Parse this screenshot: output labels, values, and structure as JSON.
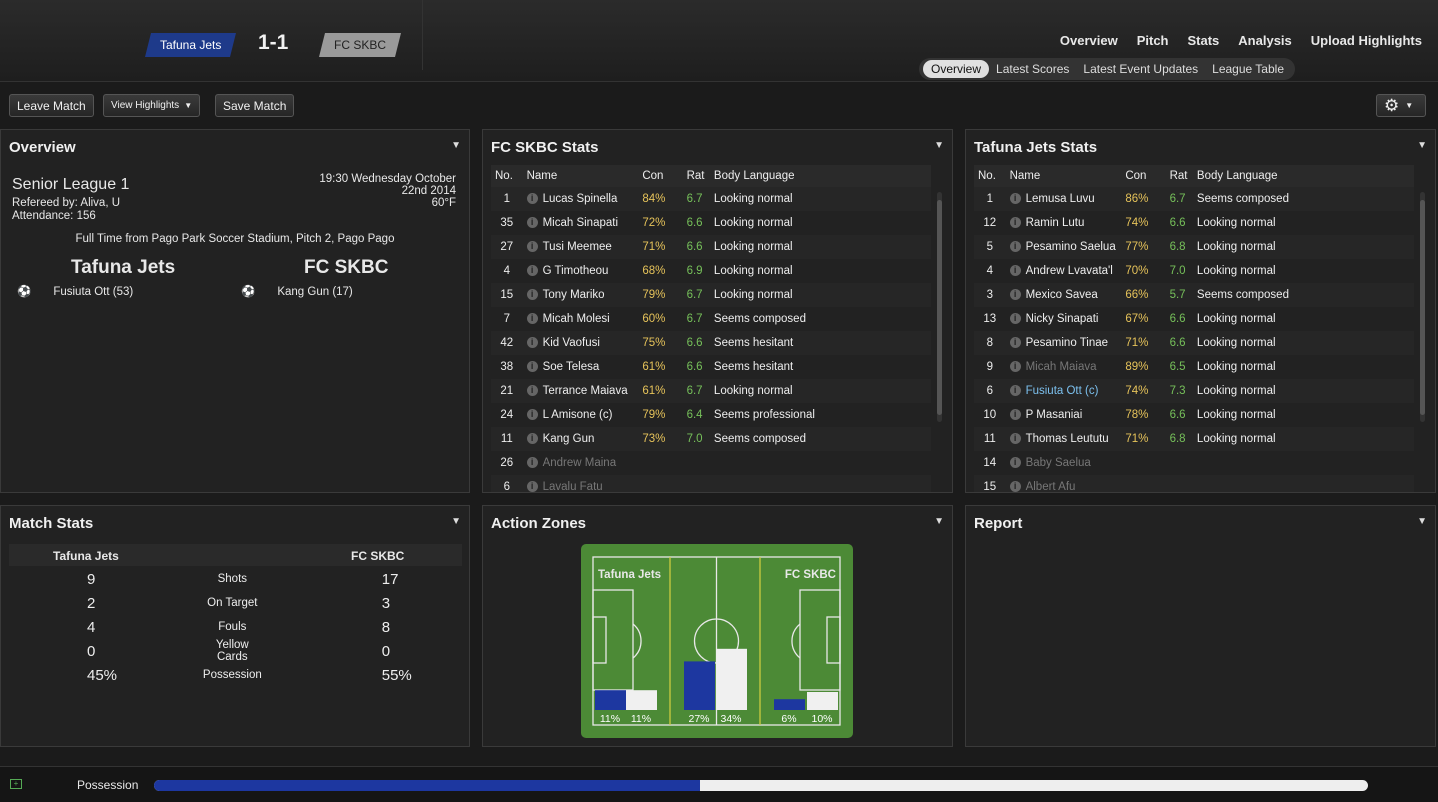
{
  "header": {
    "home_team": "Tafuna Jets",
    "away_team": "FC SKBC",
    "score": "1-1",
    "nav": [
      "Overview",
      "Pitch",
      "Stats",
      "Analysis",
      "Upload Highlights"
    ],
    "subnav": [
      "Overview",
      "Latest Scores",
      "Latest Event Updates",
      "League Table"
    ]
  },
  "toolbar": {
    "leave": "Leave Match",
    "highlights": "View Highlights",
    "save": "Save Match"
  },
  "overview": {
    "title": "Overview",
    "league": "Senior League 1",
    "referee": "Refereed by: Aliva, U",
    "attendance": "Attendance: 156",
    "datetime1": "19:30 Wednesday October",
    "datetime2": "22nd 2014",
    "temp": "60°F",
    "venue": "Full Time from Pago Park Soccer Stadium, Pitch 2, Pago Pago",
    "home": "Tafuna Jets",
    "away": "FC SKBC",
    "home_scorer": "Fusiuta Ott (53)",
    "away_scorer": "Kang Gun (17)"
  },
  "stats_headers": [
    "No.",
    "Name",
    "Con",
    "Rat",
    "Body Language"
  ],
  "fcskbc": {
    "title": "FC SKBC Stats",
    "rows": [
      [
        "1",
        "Lucas Spinella",
        "84%",
        "6.7",
        "Looking normal"
      ],
      [
        "35",
        "Micah Sinapati",
        "72%",
        "6.6",
        "Looking normal"
      ],
      [
        "27",
        "Tusi Meemee",
        "71%",
        "6.6",
        "Looking normal"
      ],
      [
        "4",
        "G Timotheou",
        "68%",
        "6.9",
        "Looking normal"
      ],
      [
        "15",
        "Tony Mariko",
        "79%",
        "6.7",
        "Looking normal"
      ],
      [
        "7",
        "Micah Molesi",
        "60%",
        "6.7",
        "Seems composed"
      ],
      [
        "42",
        "Kid Vaofusi",
        "75%",
        "6.6",
        "Seems hesitant"
      ],
      [
        "38",
        "Soe Telesa",
        "61%",
        "6.6",
        "Seems hesitant"
      ],
      [
        "21",
        "Terrance Maiava",
        "61%",
        "6.7",
        "Looking normal"
      ],
      [
        "24",
        "L Amisone (c)",
        "79%",
        "6.4",
        "Seems professional"
      ],
      [
        "11",
        "Kang Gun",
        "73%",
        "7.0",
        "Seems composed"
      ],
      [
        "26",
        "Andrew Maina",
        "",
        "",
        ""
      ],
      [
        "6",
        "Lavalu Fatu",
        "",
        "",
        ""
      ]
    ]
  },
  "tafuna": {
    "title": "Tafuna Jets Stats",
    "rows": [
      [
        "1",
        "Lemusa Luvu",
        "86%",
        "6.7",
        "Seems composed"
      ],
      [
        "12",
        "Ramin Lutu",
        "74%",
        "6.6",
        "Looking normal"
      ],
      [
        "5",
        "Pesamino Saelua",
        "77%",
        "6.8",
        "Looking normal"
      ],
      [
        "4",
        "Andrew Lvavata'l",
        "70%",
        "7.0",
        "Looking normal"
      ],
      [
        "3",
        "Mexico Savea",
        "66%",
        "5.7",
        "Seems composed"
      ],
      [
        "13",
        "Nicky Sinapati",
        "67%",
        "6.6",
        "Looking normal"
      ],
      [
        "8",
        "Pesamino Tinae",
        "71%",
        "6.6",
        "Looking normal"
      ],
      [
        "9",
        "Micah Maiava",
        "89%",
        "6.5",
        "Looking normal"
      ],
      [
        "6",
        "Fusiuta Ott (c)",
        "74%",
        "7.3",
        "Looking normal"
      ],
      [
        "10",
        "P Masaniai",
        "78%",
        "6.6",
        "Looking normal"
      ],
      [
        "11",
        "Thomas Leututu",
        "71%",
        "6.8",
        "Looking normal"
      ],
      [
        "14",
        "Baby Saelua",
        "",
        "",
        ""
      ],
      [
        "15",
        "Albert Afu",
        "",
        "",
        ""
      ]
    ]
  },
  "match_stats": {
    "title": "Match Stats",
    "home": "Tafuna Jets",
    "away": "FC SKBC",
    "rows": [
      [
        "9",
        "Shots",
        "17"
      ],
      [
        "2",
        "On Target",
        "3"
      ],
      [
        "4",
        "Fouls",
        "8"
      ],
      [
        "0",
        "Yellow Cards",
        "0"
      ],
      [
        "45%",
        "Possession",
        "55%"
      ]
    ]
  },
  "zones": {
    "title": "Action Zones",
    "home": "Tafuna Jets",
    "away": "FC SKBC",
    "home_pct": [
      "11%",
      "27%",
      "6%"
    ],
    "away_pct": [
      "11%",
      "34%",
      "10%"
    ]
  },
  "report": {
    "title": "Report"
  },
  "possession": {
    "label": "Possession",
    "home_fraction": 0.45
  }
}
